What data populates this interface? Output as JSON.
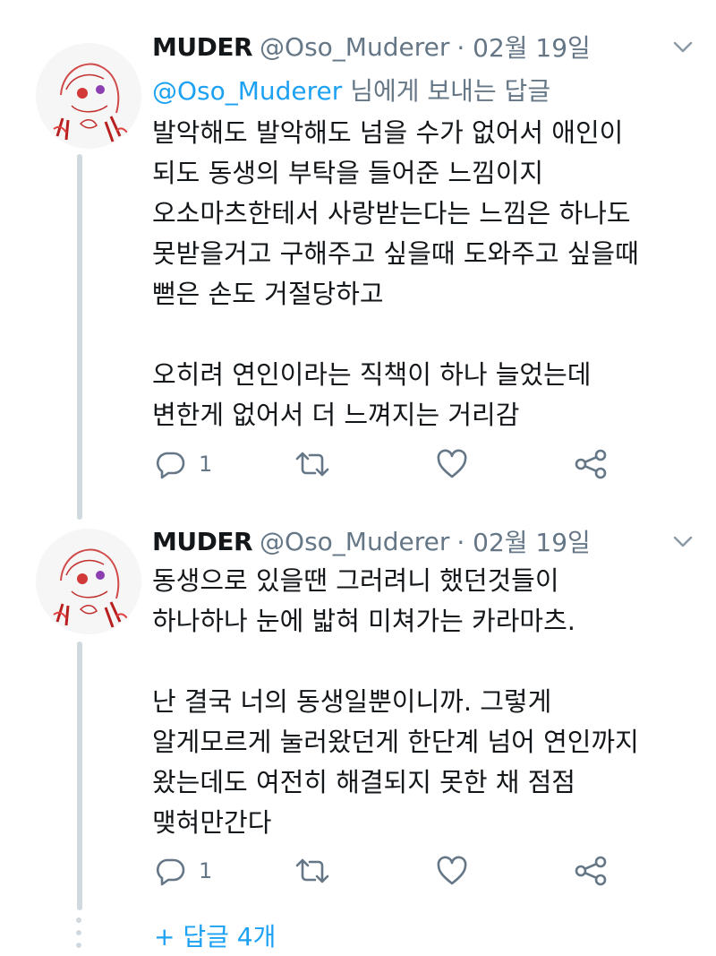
{
  "tweets": [
    {
      "name": "MUDER",
      "handle": "@Oso_Muderer",
      "date": "· 02월 19일",
      "reply_handle": "@Oso_Muderer",
      "reply_suffix": " 님에게 보내는 답글",
      "text": "발악해도 발악해도 넘을 수가 없어서 애인이\n되도 동생의 부탁을 들어준 느낌이지\n오소마츠한테서 사랑받는다는 느낌은 하나도\n못받을거고 구해주고 싶을때 도와주고 싶을때\n뻗은 손도 거절당하고\n\n오히려 연인이라는 직책이 하나 늘었는데\n변한게 없어서 더 느껴지는 거리감",
      "reply_count": "1",
      "retweet_count": "",
      "like_count": ""
    },
    {
      "name": "MUDER",
      "handle": "@Oso_Muderer",
      "date": "· 02월 19일",
      "text": "동생으로 있을땐 그러려니 했던것들이\n하나하나 눈에 밟혀 미쳐가는 카라마츠.\n\n난 결국 너의 동생일뿐이니까. 그렇게\n알게모르게 눌러왔던게 한단계 넘어 연인까지\n왔는데도 여전히 해결되지 못한 채 점점\n맺혀만간다",
      "reply_count": "1",
      "retweet_count": "",
      "like_count": ""
    }
  ],
  "more_replies": "+ 답글 4개",
  "icons": [
    "avatar",
    "chevron-down-icon",
    "reply-icon",
    "retweet-icon",
    "like-icon",
    "share-icon"
  ],
  "colors": {
    "accent": "#1da1f2",
    "muted": "#657786",
    "text": "#14171a",
    "thread": "#cfd9de"
  }
}
